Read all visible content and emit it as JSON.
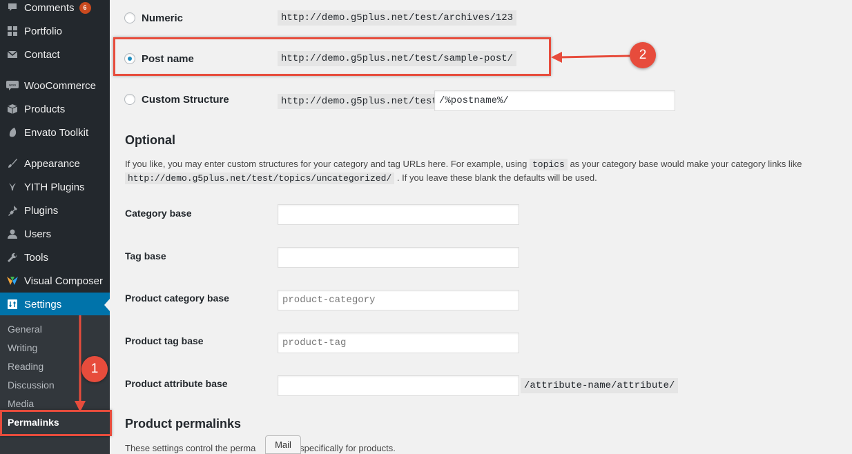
{
  "sidebar": {
    "items": [
      {
        "label": "Comments",
        "icon": "comments-icon",
        "badge": "6"
      },
      {
        "label": "Portfolio",
        "icon": "portfolio-icon"
      },
      {
        "label": "Contact",
        "icon": "mail-icon"
      },
      {
        "label": "WooCommerce",
        "icon": "woocommerce-icon"
      },
      {
        "label": "Products",
        "icon": "box-icon"
      },
      {
        "label": "Envato Toolkit",
        "icon": "envato-icon"
      },
      {
        "label": "Appearance",
        "icon": "paintbrush-icon"
      },
      {
        "label": "YITH Plugins",
        "icon": "yith-icon"
      },
      {
        "label": "Plugins",
        "icon": "plugin-icon"
      },
      {
        "label": "Users",
        "icon": "user-icon"
      },
      {
        "label": "Tools",
        "icon": "wrench-icon"
      },
      {
        "label": "Visual Composer",
        "icon": "visual-composer-icon"
      },
      {
        "label": "Settings",
        "icon": "settings-icon",
        "active": true
      }
    ],
    "submenu": [
      {
        "label": "General"
      },
      {
        "label": "Writing"
      },
      {
        "label": "Reading"
      },
      {
        "label": "Discussion"
      },
      {
        "label": "Media"
      },
      {
        "label": "Permalinks",
        "current": true
      }
    ]
  },
  "permalink_options": {
    "numeric": {
      "label": "Numeric",
      "url": "http://demo.g5plus.net/test/archives/123"
    },
    "post_name": {
      "label": "Post name",
      "url": "http://demo.g5plus.net/test/sample-post/",
      "selected": true
    },
    "custom": {
      "label": "Custom Structure",
      "url": "http://demo.g5plus.net/test",
      "value": "/%postname%/"
    }
  },
  "optional": {
    "title": "Optional",
    "desc_part1": "If you like, you may enter custom structures for your category and tag URLs here. For example, using",
    "desc_code1": "topics",
    "desc_part2": "as your category base would make your category links like",
    "desc_code2": "http://demo.g5plus.net/test/topics/uncategorized/",
    "desc_part3": ". If you leave these blank the defaults will be used.",
    "fields": {
      "category_base": {
        "label": "Category base",
        "value": ""
      },
      "tag_base": {
        "label": "Tag base",
        "value": ""
      },
      "product_category_base": {
        "label": "Product category base",
        "placeholder": "product-category"
      },
      "product_tag_base": {
        "label": "Product tag base",
        "placeholder": "product-tag"
      },
      "product_attribute_base": {
        "label": "Product attribute base",
        "value": "",
        "suffix": "/attribute-name/attribute/"
      }
    }
  },
  "product_permalinks": {
    "title": "Product permalinks",
    "desc_before": "These settings control the perma",
    "desc_after": "d specifically for products."
  },
  "tooltip": "Mail",
  "annotations": {
    "step1": "1",
    "step2": "2",
    "color": "#e74c3c"
  }
}
